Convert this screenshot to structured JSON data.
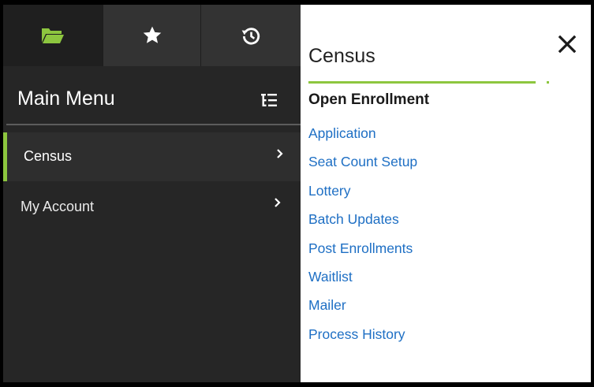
{
  "tabs": [
    {
      "icon": "folder-open-icon",
      "color": "#8dc63f"
    },
    {
      "icon": "star-icon",
      "color": "#ffffff"
    },
    {
      "icon": "history-icon",
      "color": "#ffffff"
    }
  ],
  "menu": {
    "title": "Main Menu",
    "toggle_icon": "list-tree-icon"
  },
  "nav": [
    {
      "label": "Census",
      "active": true
    },
    {
      "label": "My Account",
      "active": false
    }
  ],
  "panel": {
    "title": "Census",
    "close_icon": "close-icon",
    "section_heading": "Open Enrollment",
    "links": [
      "Application",
      "Seat Count Setup",
      "Lottery",
      "Batch Updates",
      "Post Enrollments",
      "Waitlist",
      "Mailer",
      "Process History"
    ]
  },
  "colors": {
    "accent": "#8dc63f",
    "link": "#1e6fc4",
    "sidebar_bg": "#262626"
  }
}
